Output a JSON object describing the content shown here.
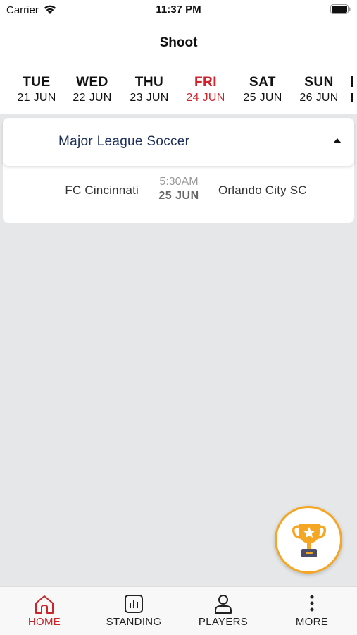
{
  "status_bar": {
    "carrier": "Carrier",
    "time": "11:37 PM"
  },
  "header": {
    "title": "Shoot"
  },
  "days": [
    {
      "name": "TUE",
      "date": "21 JUN",
      "active": false
    },
    {
      "name": "WED",
      "date": "22 JUN",
      "active": false
    },
    {
      "name": "THU",
      "date": "23 JUN",
      "active": false
    },
    {
      "name": "FRI",
      "date": "24 JUN",
      "active": true
    },
    {
      "name": "SAT",
      "date": "25 JUN",
      "active": false
    },
    {
      "name": "SUN",
      "date": "26 JUN",
      "active": false
    }
  ],
  "league": {
    "name": "Major League Soccer",
    "matches": [
      {
        "home": "FC Cincinnati",
        "time": "5:30AM",
        "date": "25 JUN",
        "away": "Orlando City SC"
      }
    ]
  },
  "tabs": [
    {
      "label": "HOME",
      "icon": "home-icon",
      "active": true
    },
    {
      "label": "STANDING",
      "icon": "bar-chart-icon",
      "active": false
    },
    {
      "label": "PLAYERS",
      "icon": "person-icon",
      "active": false
    },
    {
      "label": "MORE",
      "icon": "more-vertical-icon",
      "active": false
    }
  ],
  "colors": {
    "accent_red": "#d0242c",
    "league_blue": "#1c2f5c",
    "fab_border": "#f5a623",
    "background": "#e6e7e9"
  },
  "fab": {
    "icon": "trophy-icon"
  }
}
